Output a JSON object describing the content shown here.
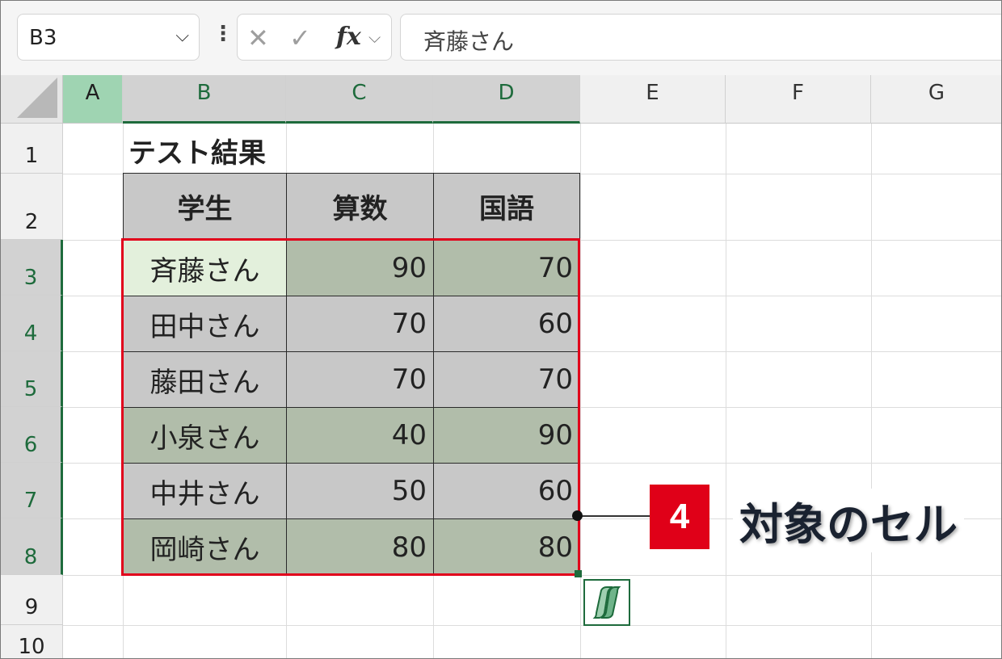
{
  "formula_bar": {
    "name_box": "B3",
    "formula_value": "斉藤さん",
    "cancel_glyph": "✕",
    "enter_glyph": "✓",
    "fx_label": "fx"
  },
  "columns": [
    "A",
    "B",
    "C",
    "D",
    "E",
    "F",
    "G"
  ],
  "rows": [
    "1",
    "2",
    "3",
    "4",
    "5",
    "6",
    "7",
    "8",
    "9",
    "10"
  ],
  "sheet": {
    "title": "テスト結果",
    "headers": [
      "学生",
      "算数",
      "国語"
    ],
    "data": [
      {
        "name": "斉藤さん",
        "math": "90",
        "japanese": "70"
      },
      {
        "name": "田中さん",
        "math": "70",
        "japanese": "60"
      },
      {
        "name": "藤田さん",
        "math": "70",
        "japanese": "70"
      },
      {
        "name": "小泉さん",
        "math": "40",
        "japanese": "90"
      },
      {
        "name": "中井さん",
        "math": "50",
        "japanese": "60"
      },
      {
        "name": "岡崎さん",
        "math": "80",
        "japanese": "80"
      }
    ]
  },
  "callout": {
    "number": "4",
    "text": "対象のセル"
  },
  "colors": {
    "accent_green": "#1e6b3c",
    "selection_red": "#e1001b",
    "band_gray": "#c8c8c8",
    "band_sage": "#b1bdaa",
    "active_cell": "#e3f0dc"
  },
  "icons": [
    "chevron-down-icon",
    "more-vertical-icon",
    "cancel-icon",
    "enter-check-icon",
    "function-icon",
    "quick-analysis-icon",
    "select-all-corner-icon"
  ]
}
